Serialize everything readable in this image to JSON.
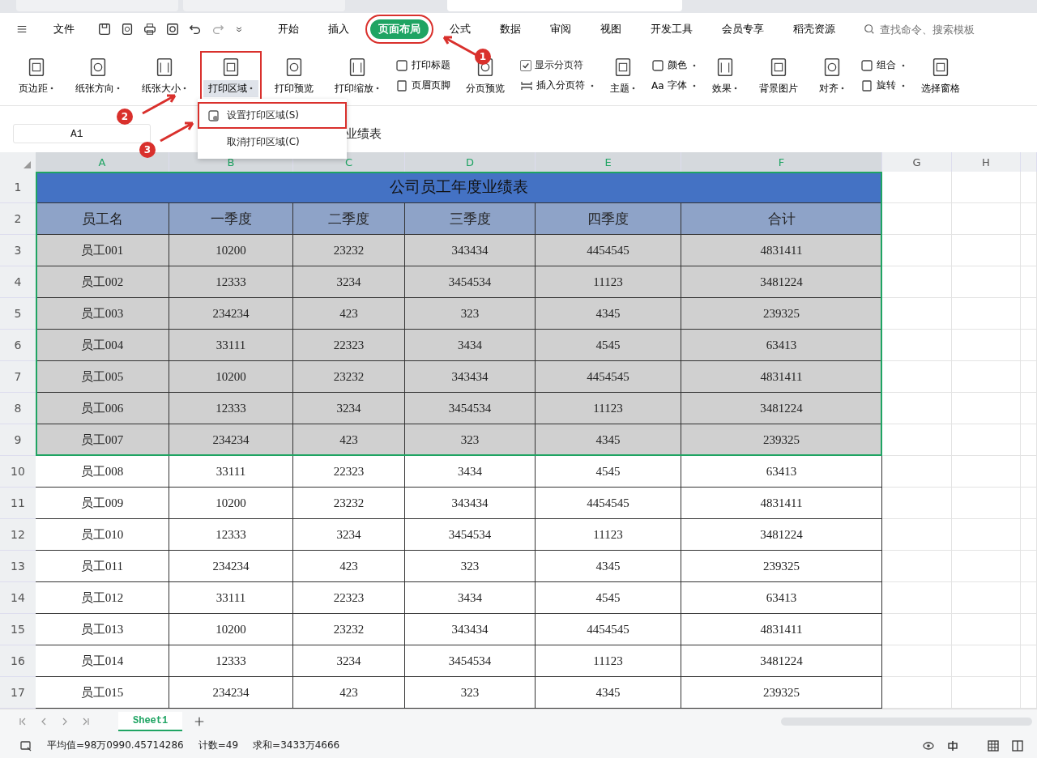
{
  "doc_tabs": [
    {
      "selected": false
    },
    {
      "selected": false
    },
    {
      "selected": true
    }
  ],
  "menu": {
    "file_label": "文件",
    "tabs": [
      {
        "label": "开始",
        "selected": false,
        "highlighted": false
      },
      {
        "label": "插入",
        "selected": false,
        "highlighted": false
      },
      {
        "label": "页面布局",
        "selected": true,
        "highlighted": true
      },
      {
        "label": "公式",
        "selected": false,
        "highlighted": false
      },
      {
        "label": "数据",
        "selected": false,
        "highlighted": false
      },
      {
        "label": "审阅",
        "selected": false,
        "highlighted": false
      },
      {
        "label": "视图",
        "selected": false,
        "highlighted": false
      },
      {
        "label": "开发工具",
        "selected": false,
        "highlighted": false
      },
      {
        "label": "会员专享",
        "selected": false,
        "highlighted": false
      },
      {
        "label": "稻壳资源",
        "selected": false,
        "highlighted": false
      }
    ],
    "search": {
      "placeholder": "查找命令、搜索模板"
    }
  },
  "ribbon": [
    {
      "kind": "big",
      "label": "页边距",
      "dropdown": true,
      "highlighted": false
    },
    {
      "kind": "big",
      "label": "纸张方向",
      "dropdown": true,
      "highlighted": false
    },
    {
      "kind": "big",
      "label": "纸张大小",
      "dropdown": true,
      "highlighted": false
    },
    {
      "kind": "big",
      "label": "打印区域",
      "dropdown": true,
      "highlighted": true
    },
    {
      "kind": "big",
      "label": "打印预览",
      "dropdown": false,
      "highlighted": false
    },
    {
      "kind": "big",
      "label": "打印缩放",
      "dropdown": true,
      "highlighted": false
    },
    {
      "kind": "pair",
      "top": "打印标题",
      "bottom": "页眉页脚",
      "dropdown": false
    },
    {
      "kind": "big",
      "label": "分页预览",
      "dropdown": false,
      "highlighted": false
    },
    {
      "kind": "check",
      "label": "显示分页符",
      "checked": true,
      "bottom": "插入分页符",
      "dropdown": true
    },
    {
      "kind": "big",
      "label": "主题",
      "dropdown": true,
      "highlighted": false
    },
    {
      "kind": "pair",
      "top": "颜色",
      "bottom": "字体",
      "bottom_prefix": "Aa",
      "dropdown": true
    },
    {
      "kind": "big",
      "label": "效果",
      "dropdown": true,
      "highlighted": false
    },
    {
      "kind": "big",
      "label": "背景图片",
      "dropdown": false,
      "highlighted": false
    },
    {
      "kind": "big",
      "label": "对齐",
      "dropdown": true,
      "highlighted": false
    },
    {
      "kind": "pair",
      "top": "组合",
      "bottom": "旋转",
      "dropdown": true
    },
    {
      "kind": "big",
      "label": "选择窗格",
      "dropdown": false,
      "highlighted": false
    }
  ],
  "dropdown_menu": [
    {
      "label": "设置打印区域(S)",
      "highlighted": true
    },
    {
      "label": "取消打印区域(C)",
      "highlighted": false
    }
  ],
  "markers": [
    {
      "label": "1"
    },
    {
      "label": "2"
    },
    {
      "label": "3"
    }
  ],
  "formula_bar": {
    "name_box": "A1",
    "value": "业绩表"
  },
  "sheet": {
    "columns": [
      "A",
      "B",
      "C",
      "D",
      "E",
      "F",
      "G",
      "H"
    ],
    "title_row_num": "1",
    "header_row_num": "2",
    "title": "公司员工年度业绩表",
    "headers": [
      "员工名",
      "一季度",
      "二季度",
      "三季度",
      "四季度",
      "合计"
    ],
    "rows": [
      {
        "num": "3",
        "selected": true,
        "cells": [
          "员工001",
          "10200",
          "23232",
          "343434",
          "4454545",
          "4831411"
        ]
      },
      {
        "num": "4",
        "selected": true,
        "cells": [
          "员工002",
          "12333",
          "3234",
          "3454534",
          "11123",
          "3481224"
        ]
      },
      {
        "num": "5",
        "selected": true,
        "cells": [
          "员工003",
          "234234",
          "423",
          "323",
          "4345",
          "239325"
        ]
      },
      {
        "num": "6",
        "selected": true,
        "cells": [
          "员工004",
          "33111",
          "22323",
          "3434",
          "4545",
          "63413"
        ]
      },
      {
        "num": "7",
        "selected": true,
        "cells": [
          "员工005",
          "10200",
          "23232",
          "343434",
          "4454545",
          "4831411"
        ]
      },
      {
        "num": "8",
        "selected": true,
        "cells": [
          "员工006",
          "12333",
          "3234",
          "3454534",
          "11123",
          "3481224"
        ]
      },
      {
        "num": "9",
        "selected": true,
        "cells": [
          "员工007",
          "234234",
          "423",
          "323",
          "4345",
          "239325"
        ]
      },
      {
        "num": "10",
        "selected": false,
        "cells": [
          "员工008",
          "33111",
          "22323",
          "3434",
          "4545",
          "63413"
        ]
      },
      {
        "num": "11",
        "selected": false,
        "cells": [
          "员工009",
          "10200",
          "23232",
          "343434",
          "4454545",
          "4831411"
        ]
      },
      {
        "num": "12",
        "selected": false,
        "cells": [
          "员工010",
          "12333",
          "3234",
          "3454534",
          "11123",
          "3481224"
        ]
      },
      {
        "num": "13",
        "selected": false,
        "cells": [
          "员工011",
          "234234",
          "423",
          "323",
          "4345",
          "239325"
        ]
      },
      {
        "num": "14",
        "selected": false,
        "cells": [
          "员工012",
          "33111",
          "22323",
          "3434",
          "4545",
          "63413"
        ]
      },
      {
        "num": "15",
        "selected": false,
        "cells": [
          "员工013",
          "10200",
          "23232",
          "343434",
          "4454545",
          "4831411"
        ]
      },
      {
        "num": "16",
        "selected": false,
        "cells": [
          "员工014",
          "12333",
          "3234",
          "3454534",
          "11123",
          "3481224"
        ]
      },
      {
        "num": "17",
        "selected": false,
        "cells": [
          "员工015",
          "234234",
          "423",
          "323",
          "4345",
          "239325"
        ]
      }
    ]
  },
  "sheet_tabs": [
    {
      "label": "Sheet1",
      "selected": true
    }
  ],
  "status_bar": {
    "average": "平均值=98万0990.45714286",
    "count": "计数=49",
    "sum": "求和=3433万4666"
  }
}
